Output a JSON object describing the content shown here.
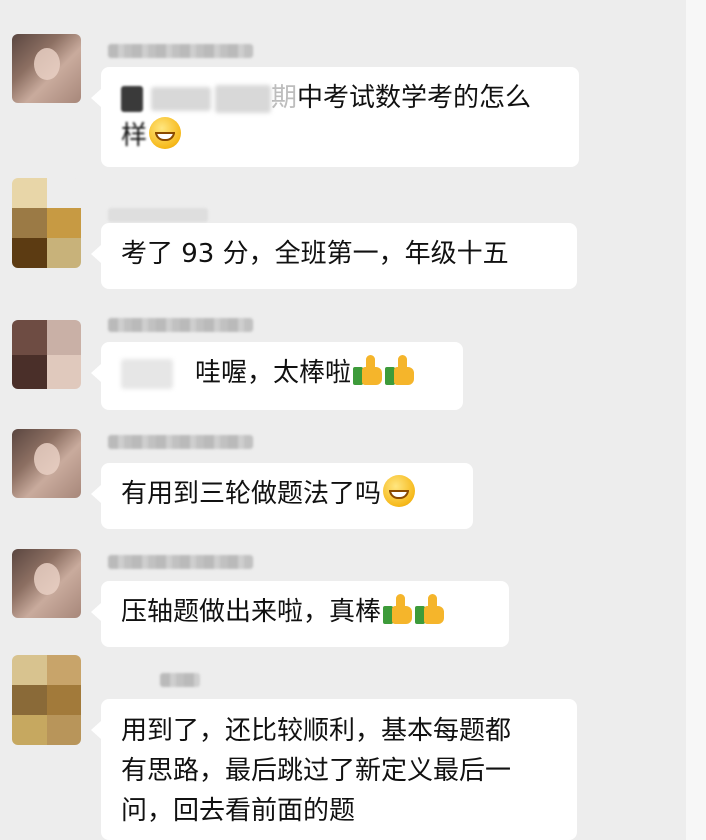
{
  "chat": {
    "messages": [
      {
        "id": "m1",
        "sender": "girl",
        "text_blurred_prefix": "",
        "text_main": "中考试数学考的怎么",
        "text_line2": "样",
        "emoji": "grin"
      },
      {
        "id": "m2",
        "sender": "mosaic-a",
        "text": "考了 93 分，全班第一，年级十五"
      },
      {
        "id": "m3",
        "sender": "mosaic-b",
        "text": "哇喔，太棒啦",
        "emoji": "thumbs-up-x2"
      },
      {
        "id": "m4",
        "sender": "girl",
        "text": "有用到三轮做题法了吗",
        "emoji": "grin"
      },
      {
        "id": "m5",
        "sender": "girl",
        "text": "压轴题做出来啦，真棒",
        "emoji": "thumbs-up-x2"
      },
      {
        "id": "m6",
        "sender": "mosaic-a",
        "lines": [
          "用到了，还比较顺利，基本每题都",
          "有思路，最后跳过了新定义最后一",
          "问，回去看前面的题"
        ]
      }
    ]
  },
  "colors": {
    "background": "#ededed",
    "bubble": "#ffffff",
    "text": "#111111"
  }
}
